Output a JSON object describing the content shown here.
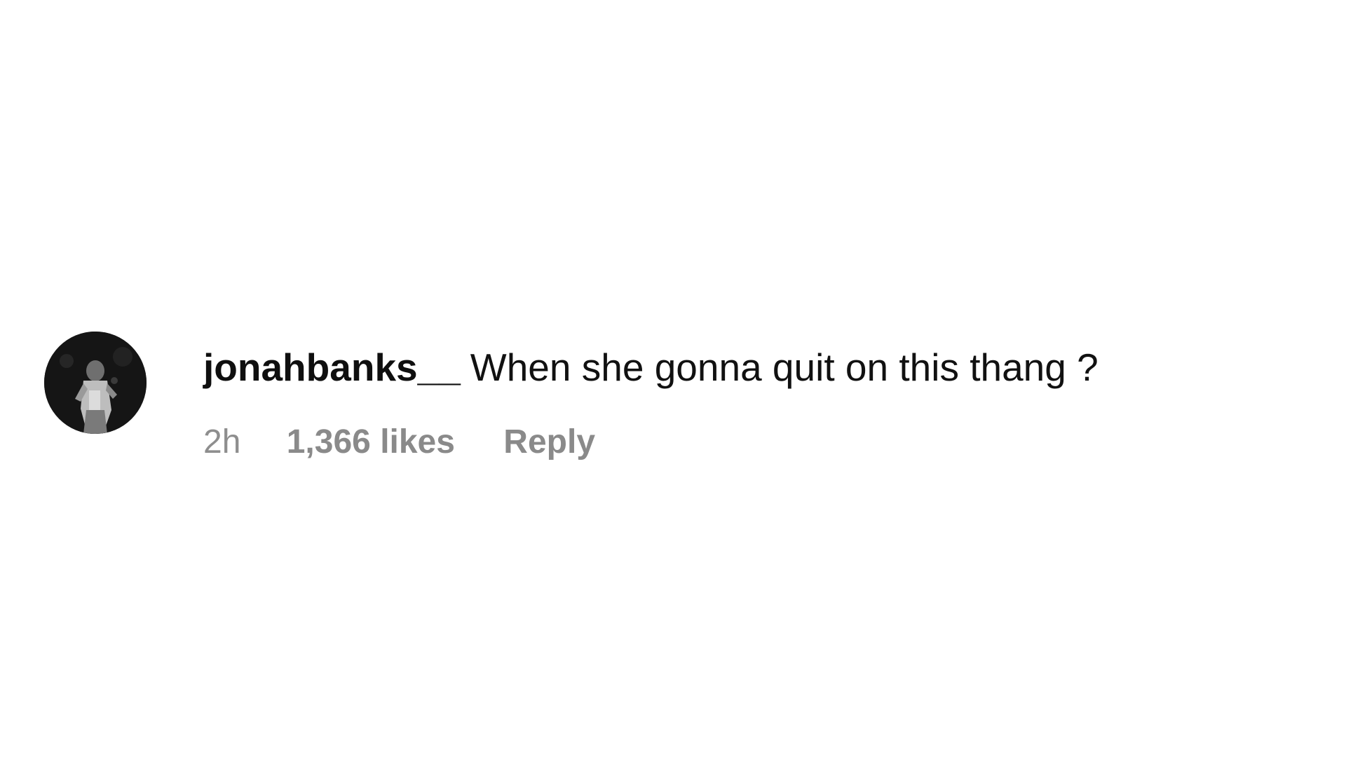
{
  "comment": {
    "username": "jonahbanks__",
    "text": "When she gonna quit on this thang ?",
    "timestamp": "2h",
    "likes": "1,366 likes",
    "reply_label": "Reply",
    "avatar_icon": "profile-photo"
  }
}
